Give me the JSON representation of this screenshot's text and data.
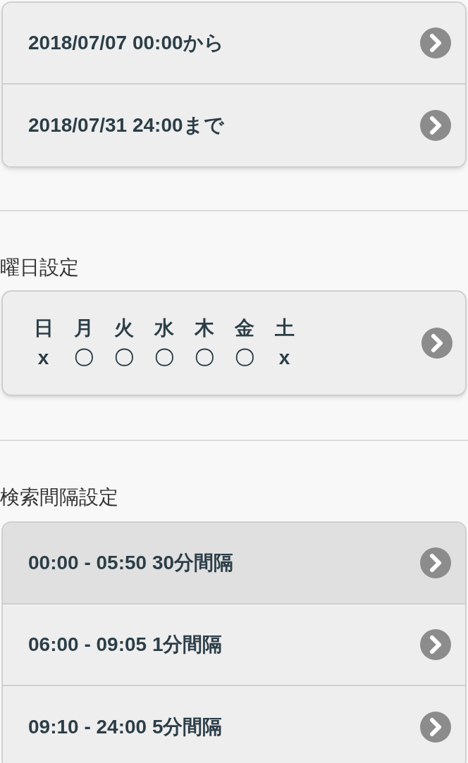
{
  "period": {
    "items": [
      {
        "label": "2018/07/07 00:00から"
      },
      {
        "label": "2018/07/31 24:00まで"
      }
    ]
  },
  "weekday_settings": {
    "heading": "曜日設定",
    "days": [
      {
        "day": "日",
        "mark": "x"
      },
      {
        "day": "月",
        "mark": "〇"
      },
      {
        "day": "火",
        "mark": "〇"
      },
      {
        "day": "水",
        "mark": "〇"
      },
      {
        "day": "木",
        "mark": "〇"
      },
      {
        "day": "金",
        "mark": "〇"
      },
      {
        "day": "土",
        "mark": "x"
      }
    ]
  },
  "interval_settings": {
    "heading": "検索間隔設定",
    "items": [
      {
        "label": "00:00 - 05:50 30分間隔",
        "selected": true
      },
      {
        "label": "06:00 - 09:05 1分間隔",
        "selected": false
      },
      {
        "label": "09:10 - 24:00 5分間隔",
        "selected": false
      }
    ]
  }
}
